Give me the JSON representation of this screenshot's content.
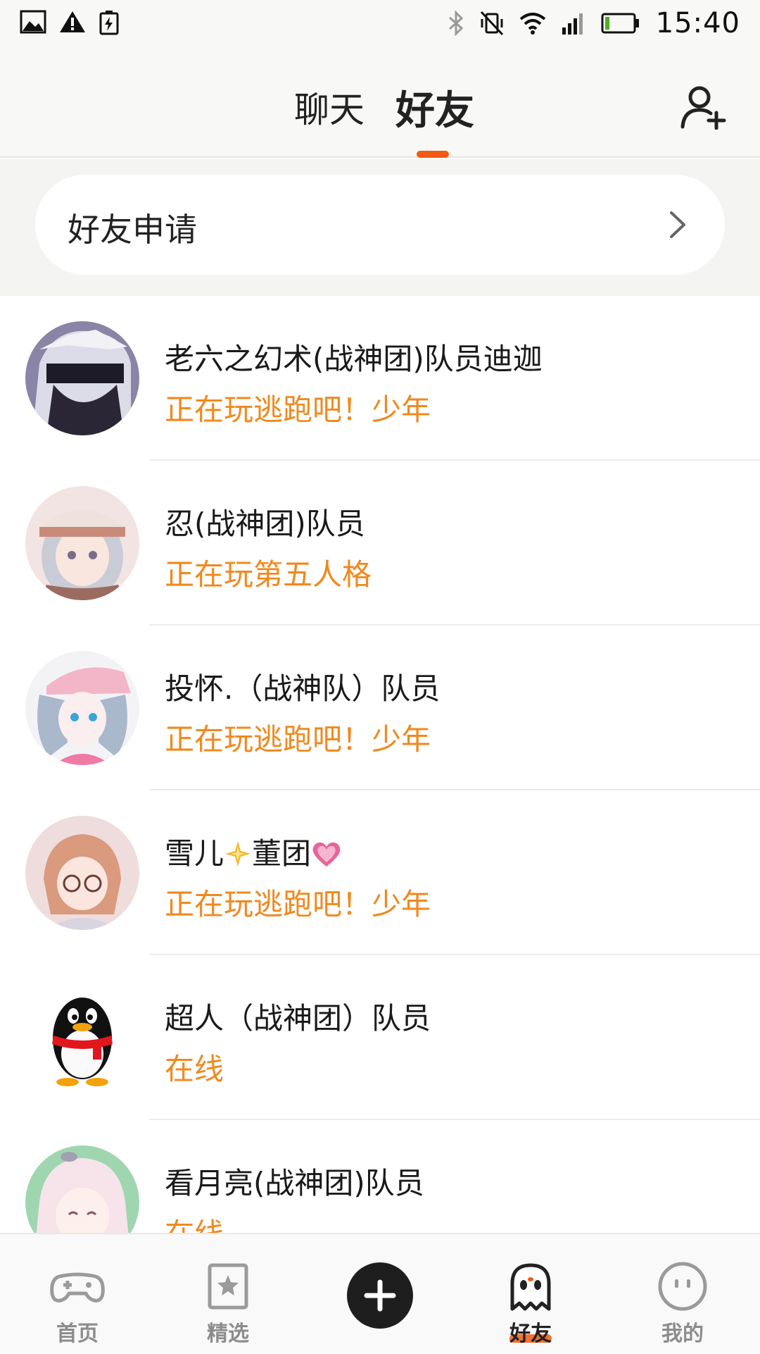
{
  "status_bar": {
    "time": "15:40",
    "icons": [
      "image-icon",
      "warning-icon",
      "battery-saver-icon",
      "bluetooth-icon",
      "vibrate-off-icon",
      "wifi-icon",
      "signal-icon",
      "battery-icon"
    ]
  },
  "header": {
    "tabs": [
      {
        "label": "聊天",
        "active": false
      },
      {
        "label": "好友",
        "active": true
      }
    ],
    "add_friend_icon": "add-user-icon"
  },
  "friend_request": {
    "label": "好友申请"
  },
  "friends": [
    {
      "name": "老六之幻术(战神团)队员迪迦",
      "status": "正在玩逃跑吧！少年",
      "avatar": "anime-boy-blindfold"
    },
    {
      "name": "忍(战神团)队员",
      "status": "正在玩第五人格",
      "avatar": "anime-girl-cap"
    },
    {
      "name": "投怀.（战神队）队员",
      "status": "正在玩逃跑吧！少年",
      "avatar": "anime-girl-pink-cap"
    },
    {
      "name": "雪儿",
      "name_suffix": "董团",
      "status": "正在玩逃跑吧！少年",
      "avatar": "anime-girl-glasses"
    },
    {
      "name": "超人（战神团）队员",
      "status": "在线",
      "avatar": "penguin"
    },
    {
      "name": "看月亮(战神团)队员",
      "status": "在线",
      "avatar": "anime-girl-white-hair"
    }
  ],
  "bottom_nav": [
    {
      "label": "首页",
      "icon": "gamepad-icon",
      "active": false
    },
    {
      "label": "精选",
      "icon": "bookmark-star-icon",
      "active": false
    },
    {
      "label": "",
      "icon": "plus-icon",
      "active": false
    },
    {
      "label": "好友",
      "icon": "ghost-icon",
      "active": true
    },
    {
      "label": "我的",
      "icon": "smiley-icon",
      "active": false
    }
  ],
  "colors": {
    "accent": "#f05a14",
    "status_text": "#f0891e"
  }
}
